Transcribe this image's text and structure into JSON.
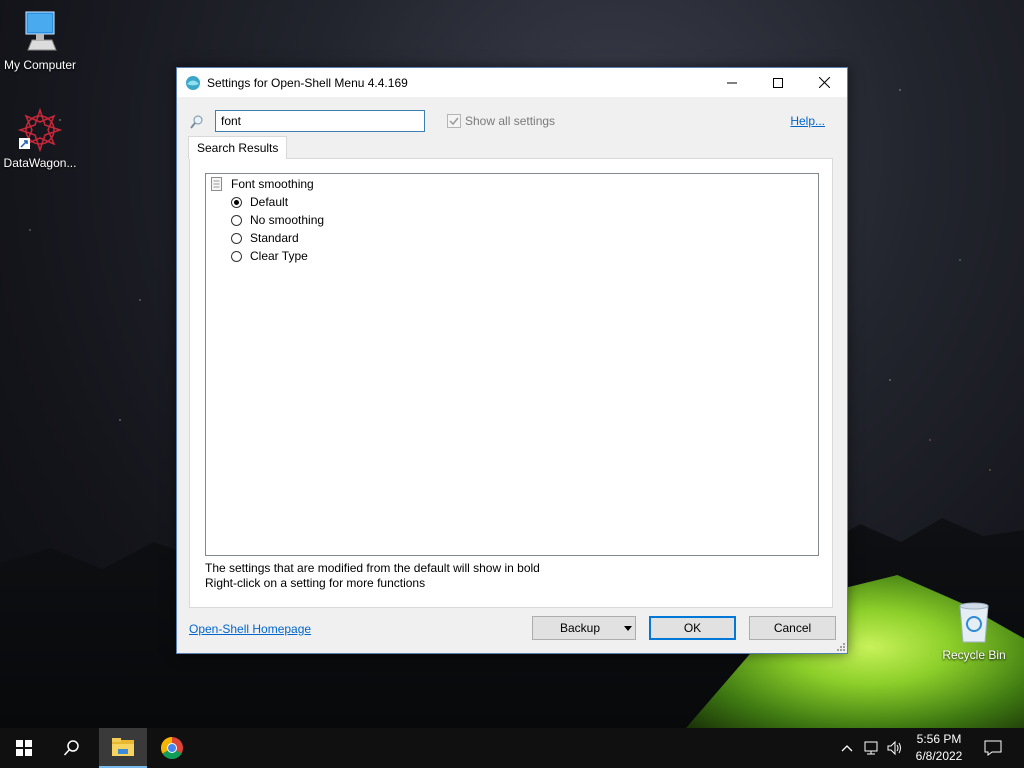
{
  "desktop": {
    "icons": [
      {
        "label": "My Computer"
      },
      {
        "label": "DataWagon..."
      },
      {
        "label": "Recycle Bin"
      }
    ]
  },
  "window": {
    "title": "Settings for Open-Shell Menu 4.4.169",
    "search": {
      "value": "font"
    },
    "show_all_label": "Show all settings",
    "show_all_checked": true,
    "help_label": "Help...",
    "tab_label": "Search Results",
    "setting": {
      "name": "Font smoothing",
      "options": [
        {
          "label": "Default",
          "selected": true
        },
        {
          "label": "No smoothing",
          "selected": false
        },
        {
          "label": "Standard",
          "selected": false
        },
        {
          "label": "Clear Type",
          "selected": false
        }
      ]
    },
    "hints": [
      "The settings that are modified from the default will show in bold",
      "Right-click on a setting for more functions"
    ],
    "homepage_label": "Open-Shell Homepage",
    "buttons": {
      "backup": "Backup",
      "ok": "OK",
      "cancel": "Cancel"
    }
  },
  "taskbar": {
    "time": "5:56 PM",
    "date": "6/8/2022",
    "apps": [
      "start-icon",
      "search-icon",
      "file-explorer-icon",
      "chrome-icon"
    ]
  },
  "colors": {
    "accent": "#0078d7",
    "link": "#0066cc",
    "taskbar": "#101010"
  }
}
